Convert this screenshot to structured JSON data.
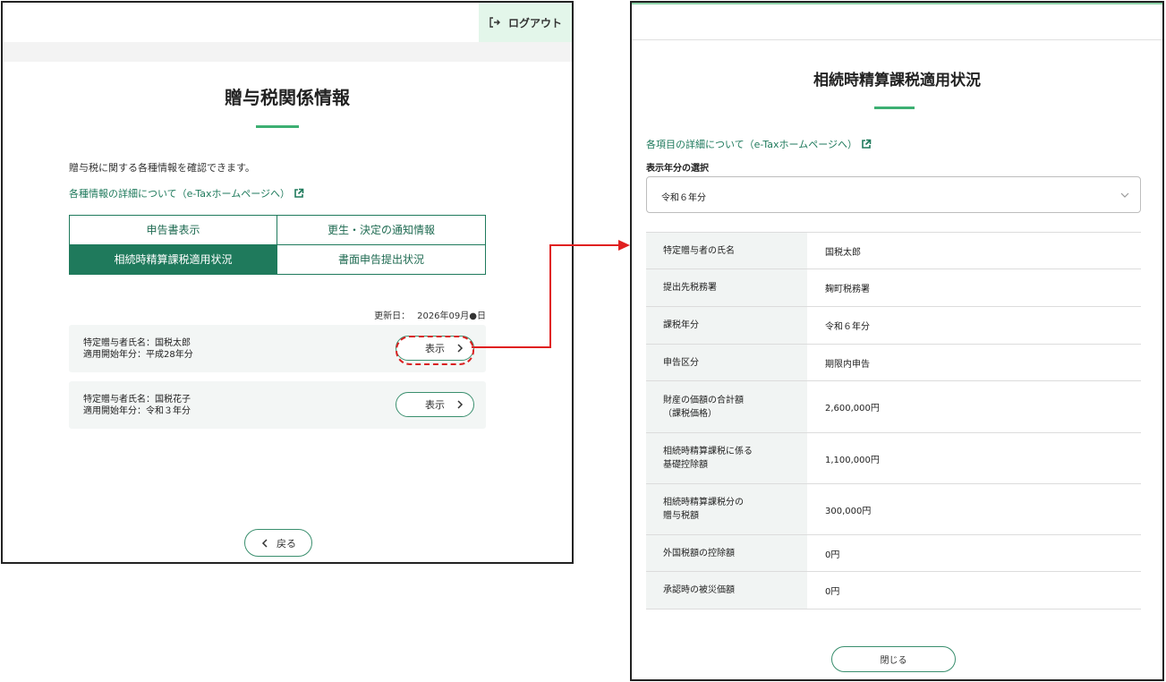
{
  "left": {
    "logout_label": "ログアウト",
    "title": "贈与税関係情報",
    "description": "贈与税に関する各種情報を確認できます。",
    "detail_link": "各種情報の詳細について（e-Taxホームページへ）",
    "tabs": [
      {
        "label": "申告書表示",
        "active": false
      },
      {
        "label": "更生・決定の通知情報",
        "active": false
      },
      {
        "label": "相続時精算課税適用状況",
        "active": true
      },
      {
        "label": "書面申告提出状況",
        "active": false
      }
    ],
    "update_label": "更新日：",
    "update_value": "2026年09月●日",
    "records": [
      {
        "line1": "特定贈与者氏名：国税太郎",
        "line2": "適用開始年分：平成28年分",
        "button": "表示"
      },
      {
        "line1": "特定贈与者氏名：国税花子",
        "line2": "適用開始年分：令和３年分",
        "button": "表示"
      }
    ],
    "back_label": "戻る"
  },
  "right": {
    "title": "相続時精算課税適用状況",
    "detail_link": "各項目の詳細について（e-Taxホームページへ）",
    "year_label": "表示年分の選択",
    "year_value": "令和６年分",
    "rows": [
      {
        "label_lines": [
          "特定贈与者の氏名"
        ],
        "value": "国税太郎",
        "height": 41
      },
      {
        "label_lines": [
          "提出先税務署"
        ],
        "value": "麹町税務署",
        "height": 42
      },
      {
        "label_lines": [
          "課税年分"
        ],
        "value": "令和６年分",
        "height": 42
      },
      {
        "label_lines": [
          "申告区分"
        ],
        "value": "期限内申告",
        "height": 41
      },
      {
        "label_lines": [
          "財産の価額の合計額",
          "（課税価格）"
        ],
        "value": "2,600,000円",
        "height": 58
      },
      {
        "label_lines": [
          "相続時精算課税に係る",
          "基礎控除額"
        ],
        "value": "1,100,000円",
        "height": 57
      },
      {
        "label_lines": [
          "相続時精算課税分の",
          "贈与税額"
        ],
        "value": "300,000円",
        "height": 57
      },
      {
        "label_lines": [
          "外国税額の控除額"
        ],
        "value": "0円",
        "height": 41
      },
      {
        "label_lines": [
          "承認時の被災価額"
        ],
        "value": "0円",
        "height": 42
      }
    ],
    "close_label": "閉じる"
  },
  "colors": {
    "accent": "#1f7a5c",
    "underline": "#3daf72",
    "highlight_red": "#d92020",
    "logout_bg": "#e3f6ea"
  },
  "icons": [
    "logout-icon",
    "external-link-icon",
    "chevron-right-icon",
    "chevron-left-icon",
    "chevron-down-icon"
  ]
}
